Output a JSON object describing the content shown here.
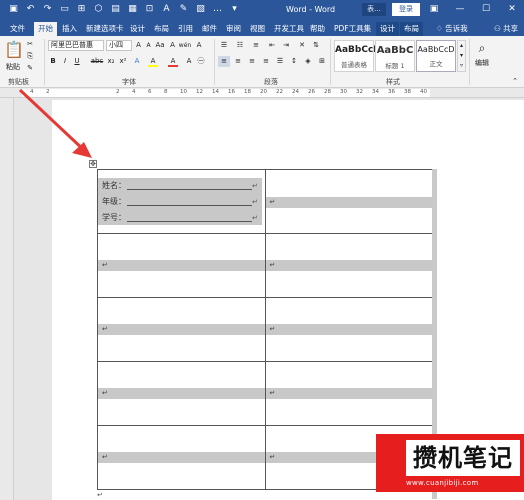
{
  "window": {
    "title": "Word - Word",
    "context_tool_tag": "表...",
    "login_label": "登录"
  },
  "qat": {
    "save_icon": "save-icon",
    "undo_icon": "undo-icon",
    "redo_icon": "redo-icon"
  },
  "tabs": [
    "文件",
    "开始",
    "插入",
    "新建选项卡",
    "设计",
    "布局",
    "引用",
    "邮件",
    "审阅",
    "视图",
    "开发工具",
    "帮助",
    "PDF工具集",
    "设计",
    "布局"
  ],
  "tell_me": "告诉我",
  "share": "共享",
  "ribbon": {
    "clipboard": {
      "paste_label": "粘贴",
      "group_label": "剪贴板"
    },
    "font": {
      "font_name": "阿里巴巴普惠",
      "font_size": "小四",
      "group_label": "字体",
      "bold": "B",
      "italic": "I",
      "underline": "U",
      "strike": "abc",
      "sub": "x₂",
      "sup": "x²",
      "grow": "A",
      "shrink": "A",
      "clear": "A",
      "phonetic": "wén",
      "border_char": "A",
      "font_color": "A",
      "highlight": "A"
    },
    "paragraph": {
      "group_label": "段落"
    },
    "styles": {
      "group_label": "样式",
      "items": [
        {
          "preview": "AaBbCcI",
          "name": "普通表格"
        },
        {
          "preview": "AaBbC",
          "name": "标题 1"
        },
        {
          "preview": "AaBbCcD",
          "name": "正文"
        }
      ]
    },
    "editing": {
      "label": "编辑"
    }
  },
  "ruler": {
    "ticks": [
      "4",
      "2",
      "2",
      "4",
      "6",
      "8",
      "10",
      "12",
      "14",
      "16",
      "18",
      "20",
      "22",
      "24",
      "26",
      "28",
      "30",
      "32",
      "34",
      "36",
      "38",
      "40"
    ]
  },
  "document": {
    "fields": [
      {
        "label": "姓名："
      },
      {
        "label": "年级："
      },
      {
        "label": "学号："
      }
    ],
    "para_mark": "↵"
  },
  "watermark": {
    "text": "攒机笔记",
    "url": "www.cuanjibiji.com"
  },
  "colors": {
    "accent": "#2b579a",
    "watermark": "#e61e1e",
    "arrow": "#e53935"
  }
}
